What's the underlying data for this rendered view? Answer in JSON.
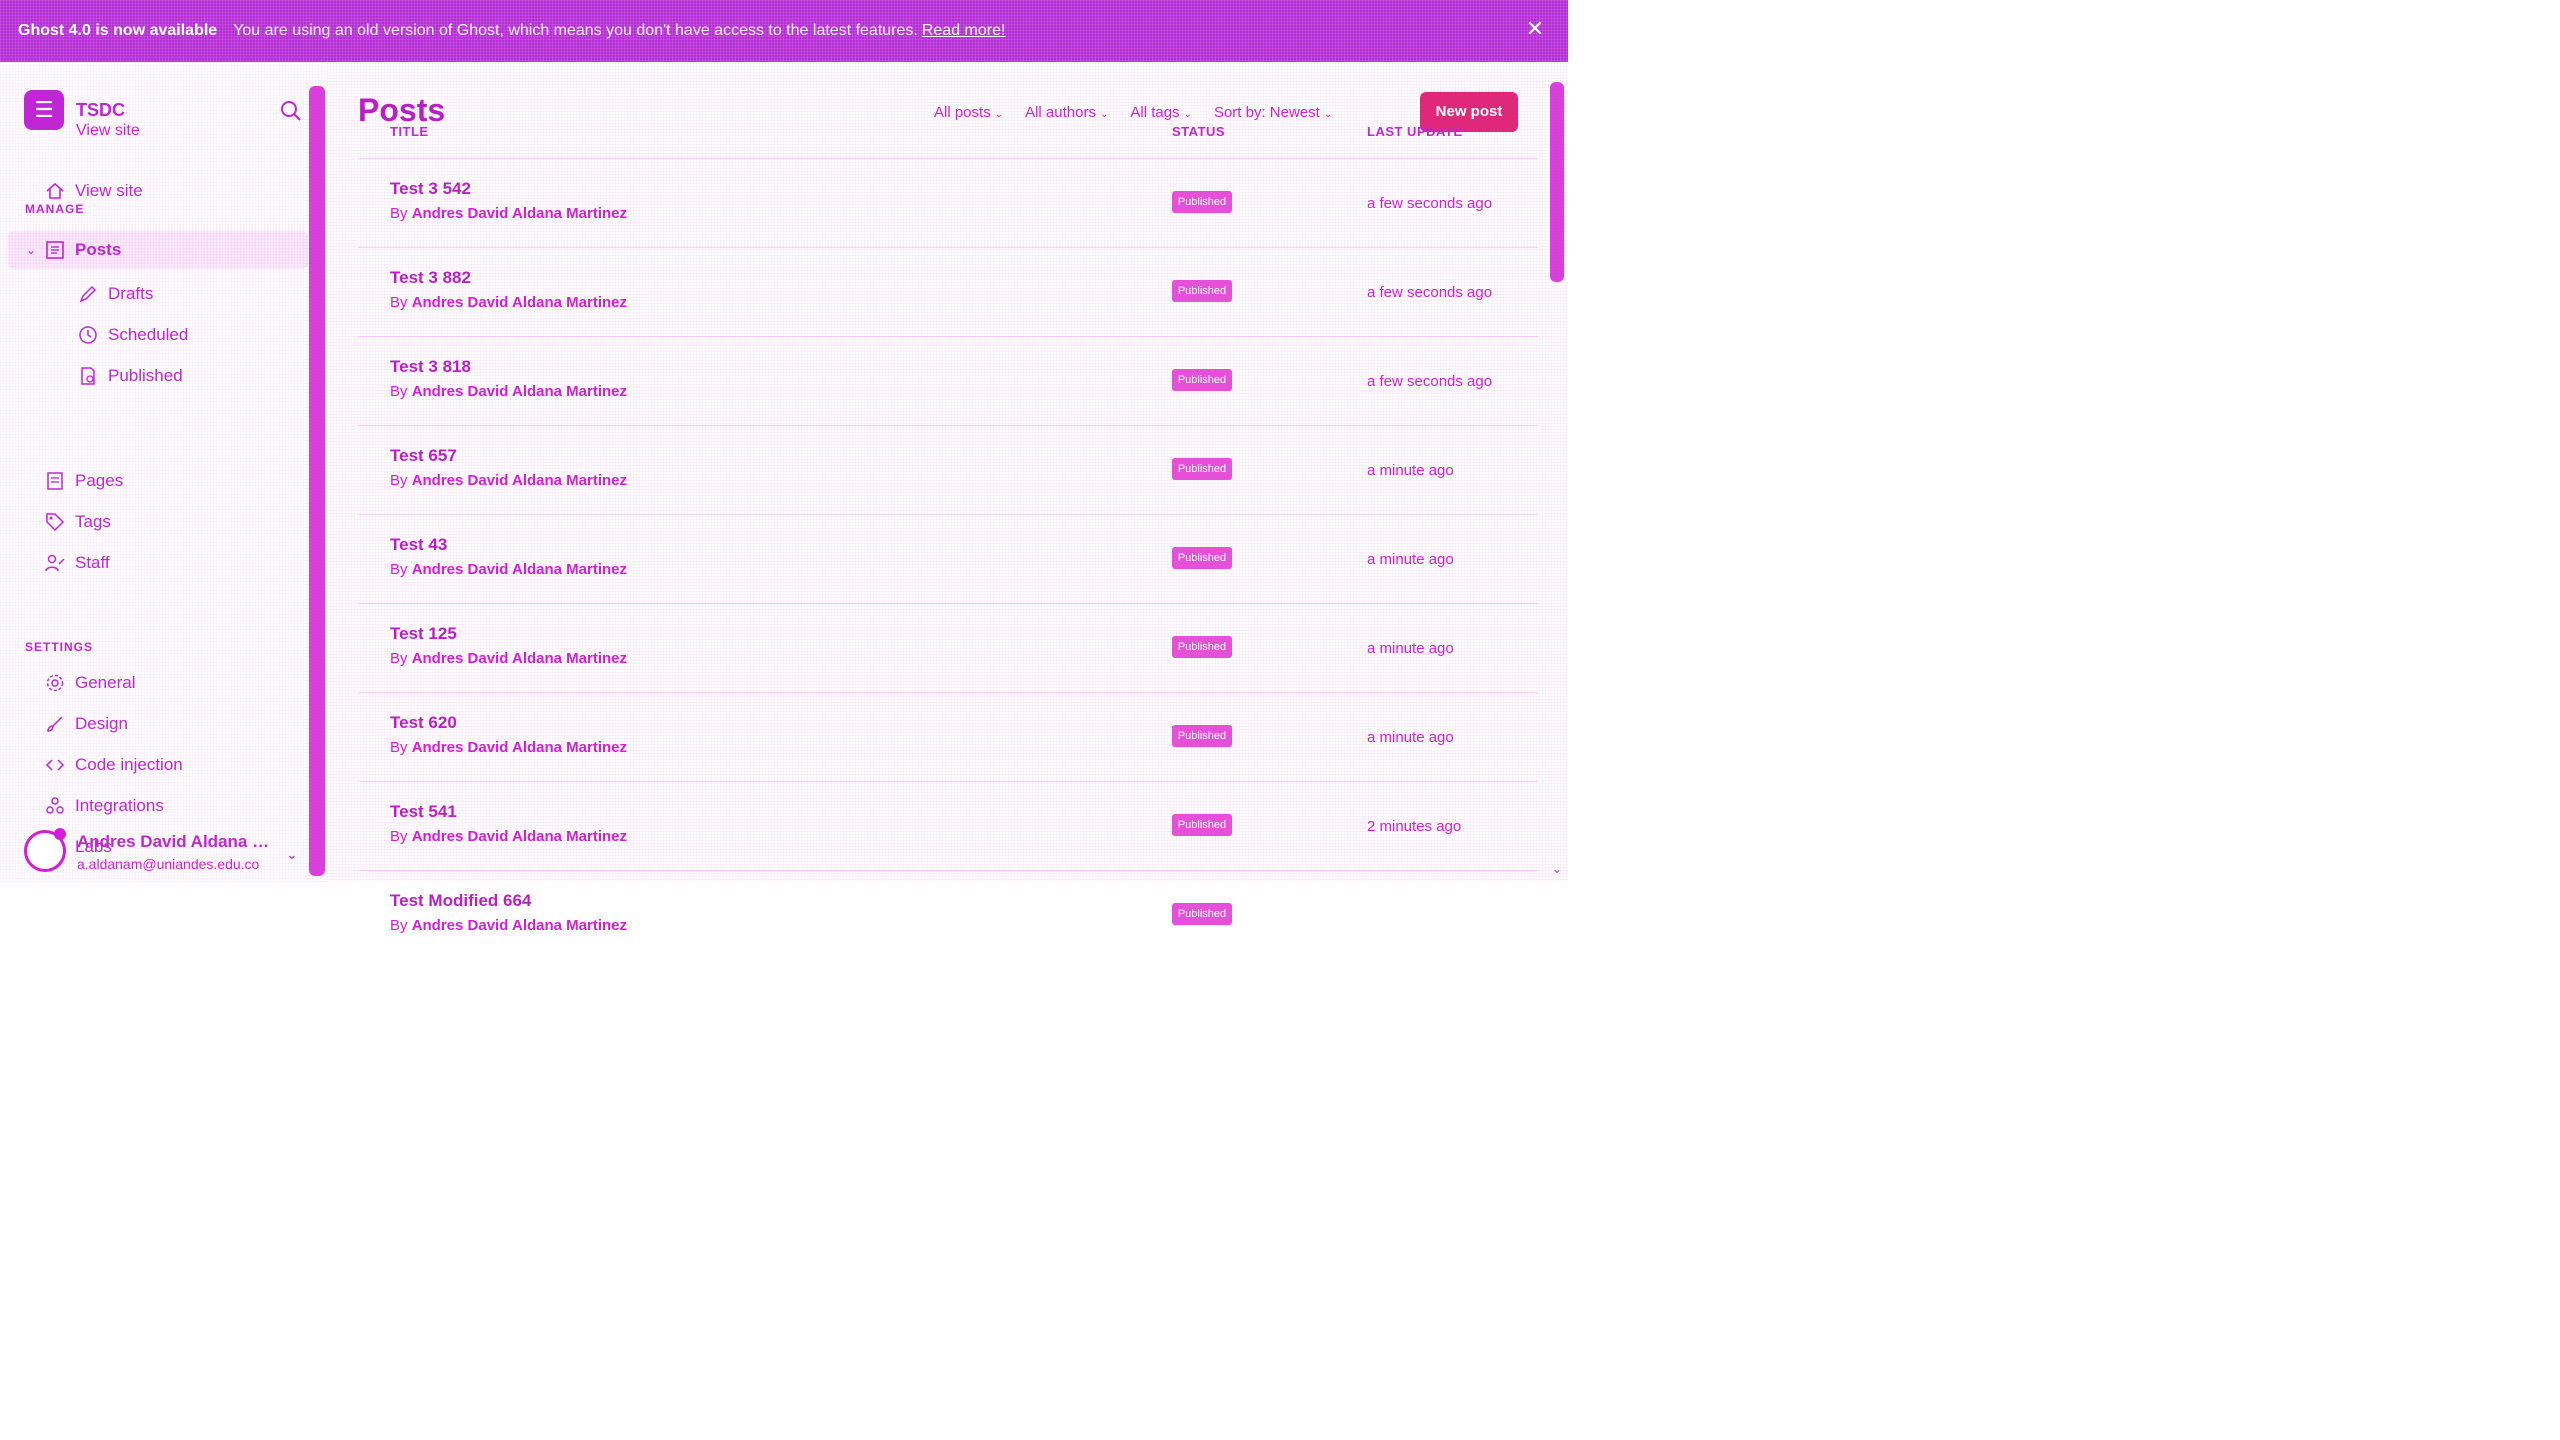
{
  "banner": {
    "headline": "Ghost 4.0 is now available",
    "message": "You are using an old version of Ghost, which means you don't have access to the latest features.",
    "link": "Read more!",
    "close_icon": "close-icon"
  },
  "sidebar": {
    "site_name": "TSDC",
    "site_link": "View site",
    "items_top": [
      {
        "label": "View site",
        "icon": "home-icon"
      }
    ],
    "manage_heading": "MANAGE",
    "posts_label": "Posts",
    "posts_subitems": [
      "Drafts",
      "Scheduled",
      "Published"
    ],
    "manage_items": [
      {
        "label": "Pages",
        "icon": "pages-icon"
      },
      {
        "label": "Tags",
        "icon": "tag-icon"
      },
      {
        "label": "Staff",
        "icon": "staff-icon"
      }
    ],
    "settings_heading": "SETTINGS",
    "settings_items": [
      {
        "label": "General",
        "icon": "gear-icon"
      },
      {
        "label": "Design",
        "icon": "brush-icon"
      },
      {
        "label": "Code injection",
        "icon": "code-icon"
      },
      {
        "label": "Integrations",
        "icon": "integrations-icon"
      },
      {
        "label": "Labs",
        "icon": "flask-icon"
      }
    ],
    "user": {
      "name": "Andres David Aldana Martinez",
      "email": "a.aldanam@uniandes.edu.co"
    }
  },
  "main": {
    "title": "Posts",
    "filters": [
      "All posts",
      "All authors",
      "All tags",
      "Sort by: Newest"
    ],
    "new_post": "New post",
    "columns": {
      "title": "TITLE",
      "status": "STATUS",
      "updated": "LAST UPDATE"
    },
    "rows": [
      {
        "title": "Test 3 542",
        "author_prefix": "By",
        "author": "Andres David Aldana Martinez",
        "status": "Published",
        "updated": "a few seconds ago"
      },
      {
        "title": "Test 3 882",
        "author_prefix": "By",
        "author": "Andres David Aldana Martinez",
        "status": "Published",
        "updated": "a few seconds ago"
      },
      {
        "title": "Test 3 818",
        "author_prefix": "By",
        "author": "Andres David Aldana Martinez",
        "status": "Published",
        "updated": "a few seconds ago"
      },
      {
        "title": "Test 657",
        "author_prefix": "By",
        "author": "Andres David Aldana Martinez",
        "status": "Published",
        "updated": "a minute ago"
      },
      {
        "title": "Test 43",
        "author_prefix": "By",
        "author": "Andres David Aldana Martinez",
        "status": "Published",
        "updated": "a minute ago"
      },
      {
        "title": "Test 125",
        "author_prefix": "By",
        "author": "Andres David Aldana Martinez",
        "status": "Published",
        "updated": "a minute ago"
      },
      {
        "title": "Test 620",
        "author_prefix": "By",
        "author": "Andres David Aldana Martinez",
        "status": "Published",
        "updated": "a minute ago"
      },
      {
        "title": "Test 541",
        "author_prefix": "By",
        "author": "Andres David Aldana Martinez",
        "status": "Published",
        "updated": "2 minutes ago"
      },
      {
        "title": "Test Modified 664",
        "author_prefix": "By",
        "author": "Andres David Aldana Martinez",
        "status": "Published",
        "updated": ""
      }
    ]
  },
  "colors": {
    "accent": "#d21fd6",
    "banner": "#b62ed6",
    "primary_button": "#e0287a"
  }
}
